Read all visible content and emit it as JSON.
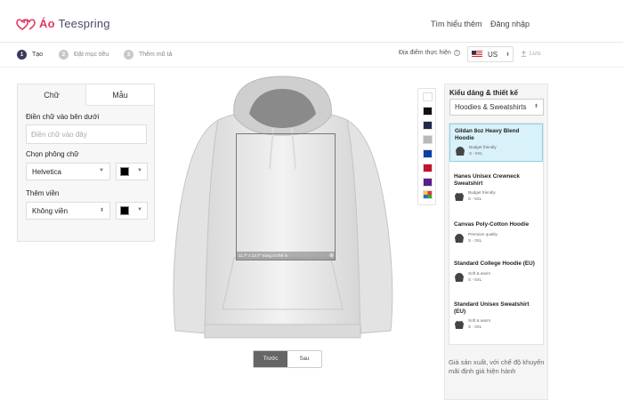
{
  "header": {
    "brand_prefix": "Áo",
    "brand_name": "Teespring",
    "learn_more": "Tìm hiểu thêm",
    "login": "Đăng nhập"
  },
  "steps": [
    {
      "num": "1",
      "label": "Tạo",
      "active": true
    },
    {
      "num": "2",
      "label": "Đặt mục tiêu",
      "active": false
    },
    {
      "num": "3",
      "label": "Thêm mô tả",
      "active": false
    }
  ],
  "location": {
    "label": "Địa điểm thực hiện",
    "country": "US",
    "save": "Lưu"
  },
  "left_panel": {
    "tabs": [
      "Chữ",
      "Mẫu"
    ],
    "text_label": "Điền chữ vào bên dưới",
    "text_placeholder": "Điền chữ vào đây",
    "font_label": "Chọn phông chữ",
    "font_value": "Helvetica",
    "outline_label": "Thêm viền",
    "outline_value": "Không viền",
    "text_color": "#000000",
    "outline_color": "#000000"
  },
  "canvas": {
    "print_size": "11.7\" x 13.7\" Vùng có thể in",
    "views": [
      "Trước",
      "Sau"
    ]
  },
  "palette": [
    "#ffffff",
    "#111111",
    "#1e2a4a",
    "#b8b8b8",
    "#0b3fa8",
    "#c8102e",
    "#5a1e8a",
    "multi"
  ],
  "right_panel": {
    "title": "Kiểu dáng & thiết kế",
    "category": "Hoodies & Sweatshirts",
    "products": [
      {
        "name": "Gildan 8oz Heavy Blend Hoodie",
        "desc": "Budget friendly",
        "sizes": "S - 5XL",
        "selected": true
      },
      {
        "name": "Hanes Unisex Crewneck Sweatshirt",
        "desc": "Budget friendly",
        "sizes": "S - 5XL",
        "selected": false
      },
      {
        "name": "Canvas Poly-Cotton Hoodie",
        "desc": "Premium quality",
        "sizes": "S - 3XL",
        "selected": false
      },
      {
        "name": "Standard College Hoodie (EU)",
        "desc": "Soft & warm",
        "sizes": "S - 5XL",
        "selected": false
      },
      {
        "name": "Standard Unisex Sweatshirt (EU)",
        "desc": "Soft & warm",
        "sizes": "S - 3XL",
        "selected": false
      }
    ],
    "note": "Giá sản xuất, với chế độ khuyến mãi định giá hiện hành"
  }
}
